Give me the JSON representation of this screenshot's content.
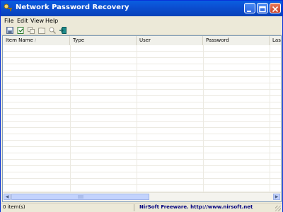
{
  "window": {
    "title": "Network Password Recovery"
  },
  "menu": {
    "items": [
      "File",
      "Edit",
      "View",
      "Help"
    ]
  },
  "toolbar": {
    "icons": [
      "save-icon",
      "export-html-icon",
      "copy-icon",
      "properties-icon",
      "find-icon",
      "exit-icon"
    ]
  },
  "list": {
    "columns": [
      "Item Name",
      "Type",
      "User",
      "Password",
      "Last"
    ],
    "rows": []
  },
  "status": {
    "items_count": "0 item(s)",
    "credit": "NirSoft Freeware.  http://www.nirsoft.net"
  },
  "colors": {
    "titlebar": "#0b4fd2",
    "frame": "#ece9d8",
    "credit_text": "#00007f"
  }
}
